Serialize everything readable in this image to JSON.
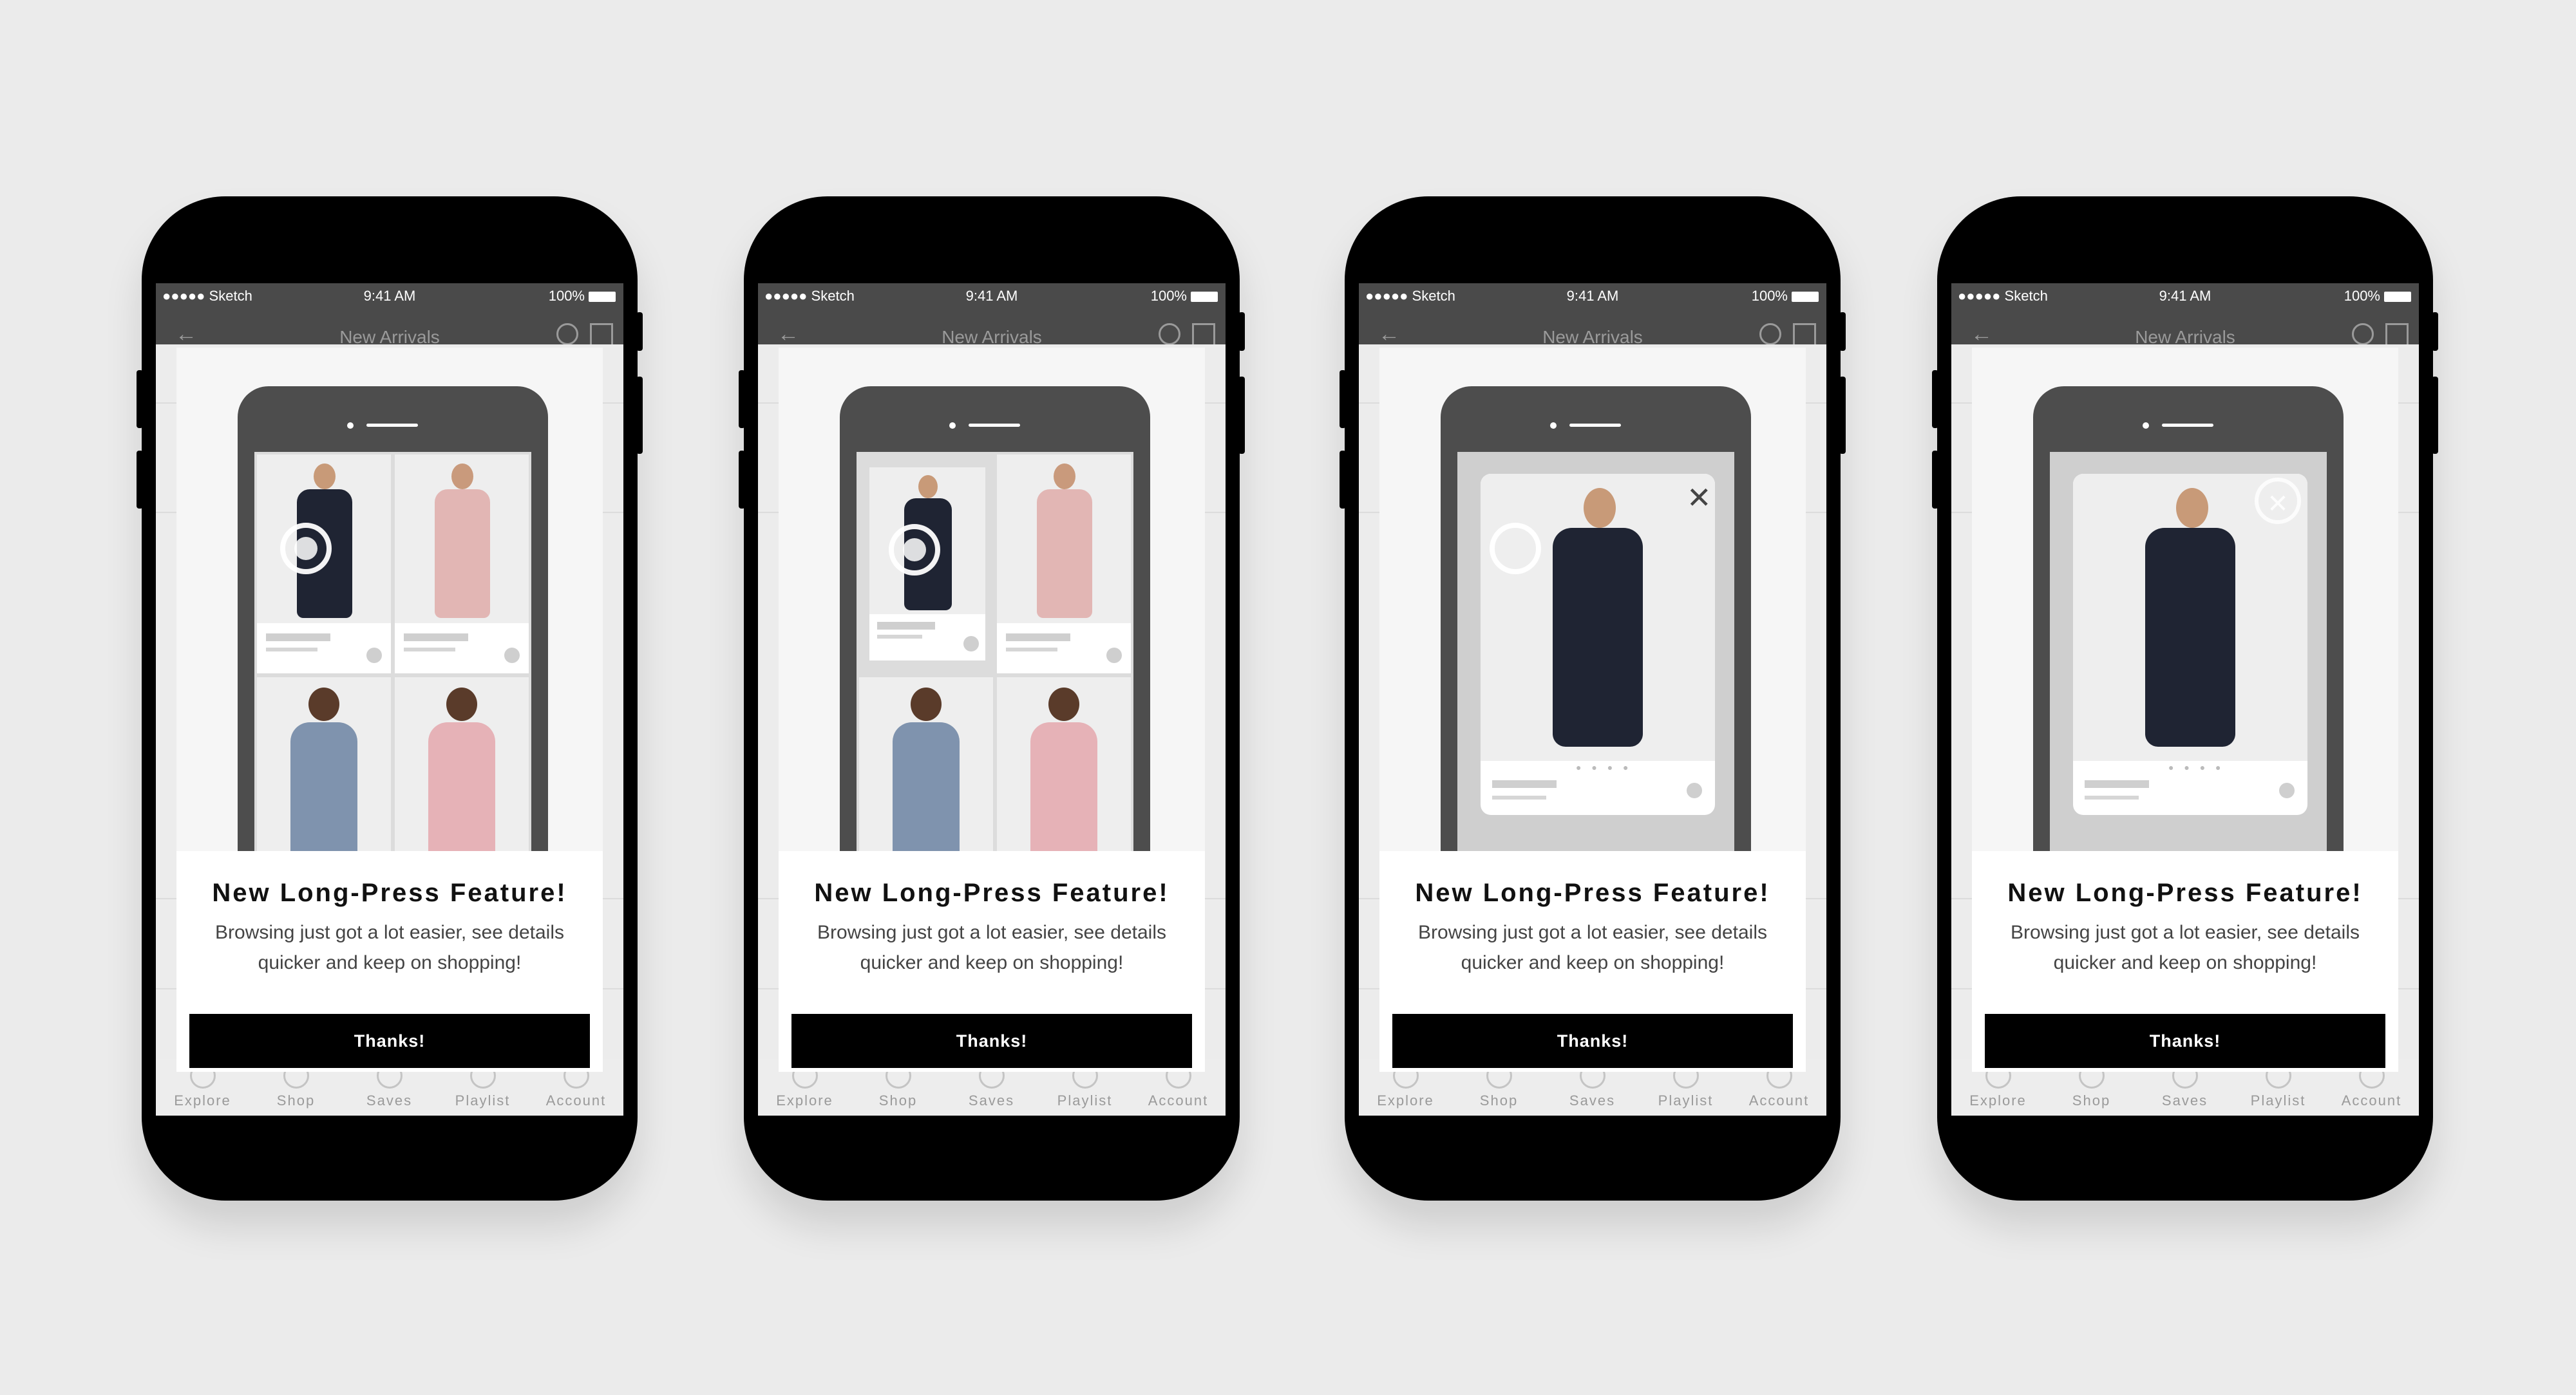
{
  "status": {
    "carrier": "●●●●● Sketch",
    "time": "9:41 AM",
    "battery": "100%"
  },
  "nav": {
    "title": "New Arrivals"
  },
  "tabs": [
    "Explore",
    "Shop",
    "Saves",
    "Playlist",
    "Account"
  ],
  "modal": {
    "title": "New Long-Press Feature!",
    "body": "Browsing just got a lot easier, see details quicker and keep on shopping!",
    "button": "Thanks!"
  },
  "colors": {
    "dress_navy": "#1f2433",
    "dress_pink": "#e2b6b4",
    "top_blue": "#7f93ae",
    "top_pink": "#e6b2b7"
  },
  "steps": [
    {
      "state": "grid-press"
    },
    {
      "state": "grid-shrink"
    },
    {
      "state": "preview-open"
    },
    {
      "state": "preview-dismiss"
    }
  ]
}
